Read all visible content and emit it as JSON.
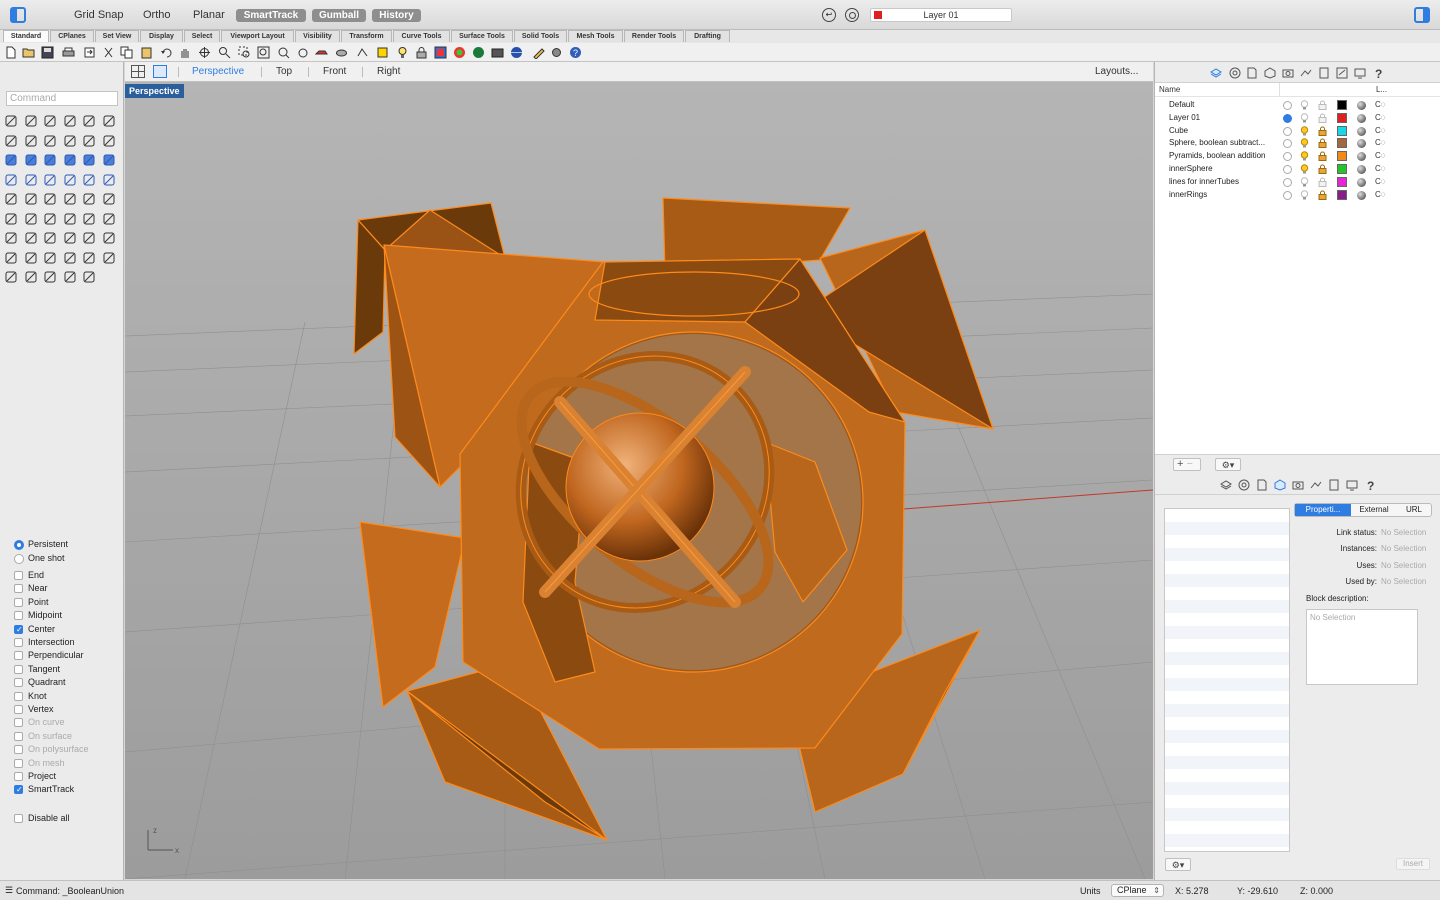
{
  "topbar": {
    "grid_snap": "Grid Snap",
    "ortho": "Ortho",
    "planar": "Planar",
    "smarttrack": "SmartTrack",
    "gumball": "Gumball",
    "history": "History",
    "current_layer": "Layer 01",
    "current_layer_color": "#e02020"
  },
  "tool_tabs": [
    "Standard",
    "CPlanes",
    "Set View",
    "Display",
    "Select",
    "Viewport Layout",
    "Visibility",
    "Transform",
    "Curve Tools",
    "Surface Tools",
    "Solid Tools",
    "Mesh Tools",
    "Render Tools",
    "Drafting"
  ],
  "command": {
    "placeholder": "Command"
  },
  "osnaps": {
    "persistent": "Persistent",
    "one_shot": "One shot",
    "items": [
      {
        "label": "End",
        "checked": false,
        "enabled": true
      },
      {
        "label": "Near",
        "checked": false,
        "enabled": true
      },
      {
        "label": "Point",
        "checked": false,
        "enabled": true
      },
      {
        "label": "Midpoint",
        "checked": false,
        "enabled": true
      },
      {
        "label": "Center",
        "checked": true,
        "enabled": true
      },
      {
        "label": "Intersection",
        "checked": false,
        "enabled": true
      },
      {
        "label": "Perpendicular",
        "checked": false,
        "enabled": true
      },
      {
        "label": "Tangent",
        "checked": false,
        "enabled": true
      },
      {
        "label": "Quadrant",
        "checked": false,
        "enabled": true
      },
      {
        "label": "Knot",
        "checked": false,
        "enabled": true
      },
      {
        "label": "Vertex",
        "checked": false,
        "enabled": true
      },
      {
        "label": "On curve",
        "checked": false,
        "enabled": false
      },
      {
        "label": "On surface",
        "checked": false,
        "enabled": false
      },
      {
        "label": "On polysurface",
        "checked": false,
        "enabled": false
      },
      {
        "label": "On mesh",
        "checked": false,
        "enabled": false
      },
      {
        "label": "Project",
        "checked": false,
        "enabled": true
      },
      {
        "label": "SmartTrack",
        "checked": true,
        "enabled": true
      }
    ],
    "disable_all": "Disable all"
  },
  "viewport_header": {
    "tabs": [
      "Perspective",
      "Top",
      "Front",
      "Right"
    ],
    "active": "Perspective",
    "layouts": "Layouts..."
  },
  "viewport": {
    "label": "Perspective",
    "axis_x": "x",
    "axis_z": "z"
  },
  "layers": {
    "header_name": "Name",
    "header_linetype": "L...",
    "rows": [
      {
        "name": "Default",
        "current": false,
        "color": "#000000",
        "on": false,
        "locked": false,
        "linetype": "C◌"
      },
      {
        "name": "Layer 01",
        "current": true,
        "color": "#e02020",
        "on": false,
        "locked": false,
        "linetype": "C◌"
      },
      {
        "name": "Cube",
        "current": false,
        "color": "#16d8e6",
        "on": true,
        "locked": true,
        "linetype": "C◌"
      },
      {
        "name": "Sphere, boolean subtract...",
        "current": false,
        "color": "#a4693a",
        "on": true,
        "locked": true,
        "linetype": "C◌"
      },
      {
        "name": "Pyramids, boolean addition",
        "current": false,
        "color": "#f28a1a",
        "on": true,
        "locked": true,
        "linetype": "C◌"
      },
      {
        "name": "innerSphere",
        "current": false,
        "color": "#22c62a",
        "on": true,
        "locked": true,
        "linetype": "C◌"
      },
      {
        "name": "lines for innerTubes",
        "current": false,
        "color": "#e624d8",
        "on": false,
        "locked": false,
        "linetype": "C◌"
      },
      {
        "name": "innerRings",
        "current": false,
        "color": "#8a1c8a",
        "on": false,
        "locked": true,
        "linetype": "C◌"
      }
    ]
  },
  "blocks": {
    "tabs": [
      "Properti...",
      "External",
      "URL"
    ],
    "link_status_label": "Link status:",
    "instances_label": "Instances:",
    "uses_label": "Uses:",
    "used_by_label": "Used by:",
    "no_selection": "No Selection",
    "description_label": "Block description:",
    "insert": "Insert"
  },
  "status": {
    "command": "Command: _BooleanUnion",
    "units": "Units",
    "cplane": "CPlane",
    "x": "X: 5.278",
    "y": "Y: -29.610",
    "z": "Z: 0.000"
  }
}
